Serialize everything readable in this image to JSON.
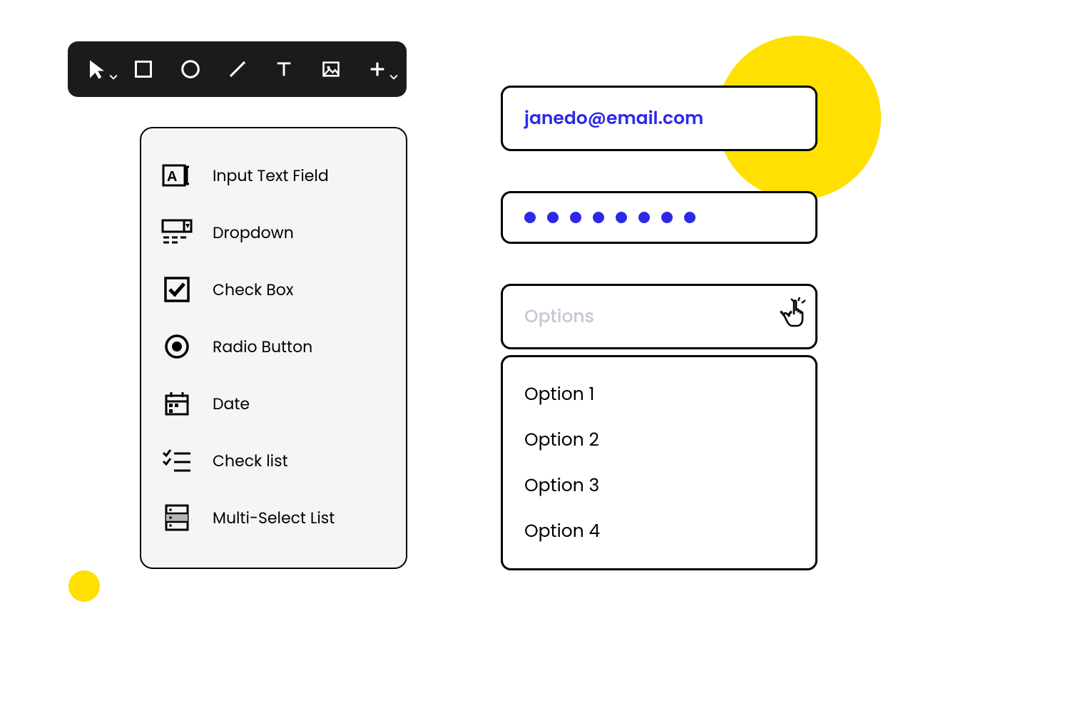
{
  "colors": {
    "accent": "#2e29e6",
    "yellow": "#ffe000",
    "toolbar": "#1b1b1b"
  },
  "toolbar": {
    "tools": [
      {
        "name": "pointer",
        "has_dropdown": true
      },
      {
        "name": "rectangle",
        "has_dropdown": false
      },
      {
        "name": "circle",
        "has_dropdown": false
      },
      {
        "name": "line",
        "has_dropdown": false
      },
      {
        "name": "text",
        "has_dropdown": false
      },
      {
        "name": "image",
        "has_dropdown": false
      },
      {
        "name": "add",
        "has_dropdown": true
      }
    ]
  },
  "palette": {
    "items": [
      {
        "icon": "input-text-field",
        "label": "Input Text Field"
      },
      {
        "icon": "dropdown",
        "label": "Dropdown"
      },
      {
        "icon": "check-box",
        "label": "Check Box"
      },
      {
        "icon": "radio-button",
        "label": "Radio Button"
      },
      {
        "icon": "date",
        "label": "Date"
      },
      {
        "icon": "check-list",
        "label": "Check list"
      },
      {
        "icon": "multi-select-list",
        "label": "Multi-Select List"
      }
    ]
  },
  "form": {
    "email_value": "janedo@email.com",
    "password_dot_count": 8,
    "dropdown": {
      "placeholder": "Options",
      "options": [
        "Option 1",
        "Option 2",
        "Option 3",
        "Option 4"
      ]
    }
  }
}
